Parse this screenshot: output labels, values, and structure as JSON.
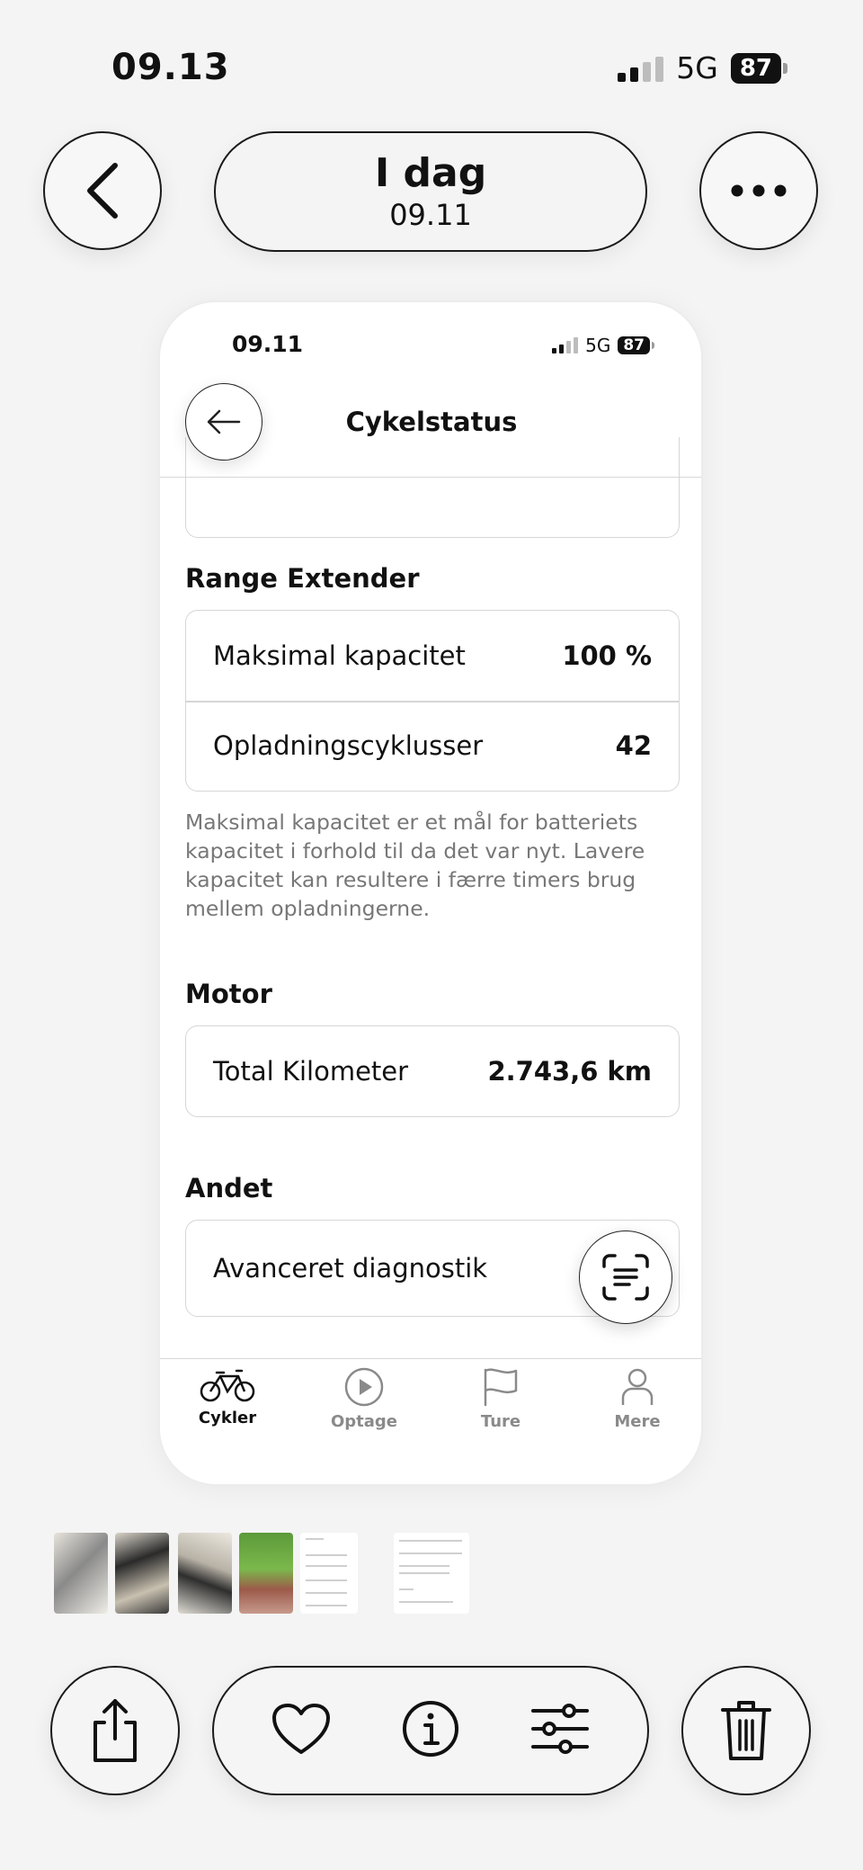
{
  "status_bar": {
    "time": "09.13",
    "network": "5G",
    "battery": "87"
  },
  "header": {
    "title": "I dag",
    "subtitle": "09.11"
  },
  "screenshot": {
    "status_bar": {
      "time": "09.11",
      "network": "5G",
      "battery": "87"
    },
    "nav_title": "Cykelstatus",
    "sections": {
      "range_extender": {
        "title": "Range Extender",
        "rows": [
          {
            "label": "Maksimal kapacitet",
            "value": "100 %"
          },
          {
            "label": "Opladningscyklusser",
            "value": "42"
          }
        ],
        "description": "Maksimal kapacitet er et mål for batteriets kapacitet i forhold til da det var nyt. Lavere kapacitet kan resultere i færre timers brug mellem opladningerne."
      },
      "motor": {
        "title": "Motor",
        "rows": [
          {
            "label": "Total Kilometer",
            "value": "2.743,6 km"
          }
        ]
      },
      "other": {
        "title": "Andet",
        "rows": [
          {
            "label": "Avanceret diagnostik"
          }
        ]
      }
    },
    "tabs": [
      {
        "label": "Cykler",
        "icon": "bike-icon",
        "active": true
      },
      {
        "label": "Optage",
        "icon": "play-icon",
        "active": false
      },
      {
        "label": "Ture",
        "icon": "flag-icon",
        "active": false
      },
      {
        "label": "Mere",
        "icon": "person-icon",
        "active": false
      }
    ]
  },
  "colors": {
    "background": "#f4f4f4",
    "text": "#111111",
    "muted": "#777777",
    "border": "#d6d6d6"
  }
}
